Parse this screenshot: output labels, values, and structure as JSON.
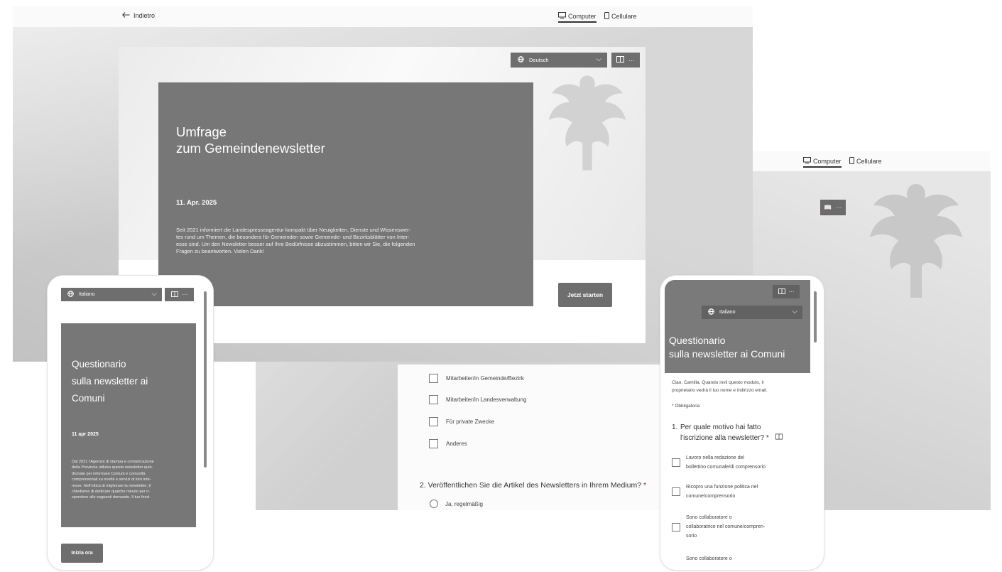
{
  "main_window": {
    "back_label": "Indietro",
    "view_toggle": {
      "computer": "Computer",
      "mobile": "Cellulare"
    },
    "language_select": "Deutsch",
    "form": {
      "title_line1": "Umfrage",
      "title_line2": "zum Gemeindenewsletter",
      "date": "11. Apr. 2025",
      "description_lines": [
        "Seit 2021 informiert die Landespresseagentur kompakt über Neuigkeiten, Dienste und Wissenswer-",
        "tes rund um Themen, die besonders für Gemeinden sowie Gemeinde- und Bezirksblätter von Inter-",
        "esse sind. Um den Newsletter besser auf Ihre Bedürfnisse abzustimmen, bitten wir Sie, die folgenden",
        "Fragen zu beantworten. Vielen Dank!"
      ],
      "start_button": "Jetzt starten"
    }
  },
  "back_window": {
    "view_toggle": {
      "computer": "Computer",
      "mobile": "Cellulare"
    },
    "options": [
      "Mitarbeiter/in Gemeinde/Bezirk",
      "Mitarbeiter/in Landesverwaltung",
      "Für private Zwecke",
      "Anderes"
    ],
    "question2": "2. Veröffentlichen Sie die Artikel des Newsletters in Ihrem Medium?",
    "question2_required": "*",
    "radio_option": "Ja, regelmäßig"
  },
  "phone_left": {
    "language_select": "Italiano",
    "title_lines": [
      "Questionario",
      "sulla newsletter ai",
      "Comuni"
    ],
    "date": "11 apr 2025",
    "description_lines": [
      "Dal 2021 l'Agenzia di stampa e comunicazione",
      "della Provincia utilizza questa newsletter quin-",
      "dicinale per informare Comuni e comunità",
      "comprensoriali su novità e servizi di loro inte-",
      "resse. Nell'ottica di migliorare la newsletter, ti",
      "chiediamo di dedicare qualche minuto per ri-",
      "spondere alle seguenti domande. Il tuo feed-"
    ],
    "start_button": "Inizia ora"
  },
  "phone_right": {
    "language_select": "Italiano",
    "title_lines": [
      "Questionario",
      "sulla newsletter ai Comuni"
    ],
    "intro_lines": [
      "Ciao, Camilla. Quando invii questo modulo, il",
      "proprietario vedrà il tuo nome e indirizzo email."
    ],
    "required_note": "* Obbligatoria",
    "question1_number": "1.",
    "question1_lines": [
      "Per quale motivo hai fatto",
      "l'iscrizione alla newsletter? *"
    ],
    "options": [
      {
        "lines": [
          "Lavoro nella redazione del",
          "bollettino comunale/di comprensorio"
        ]
      },
      {
        "lines": [
          "Ricopro una funzione politica nel",
          "comune/comprensorio"
        ]
      },
      {
        "lines": [
          "Sono collaboratore o",
          "collaboratrice nel comune/compren-",
          "sorio"
        ]
      },
      {
        "lines": [
          "Sono collaboratore o"
        ]
      }
    ]
  },
  "icons": {
    "back": "arrow-left-icon",
    "computer": "monitor-icon",
    "mobile": "phone-icon",
    "language": "globe-icon",
    "chevron": "chevron-down-icon",
    "reader": "immersive-reader-icon",
    "more": "more-icon"
  }
}
